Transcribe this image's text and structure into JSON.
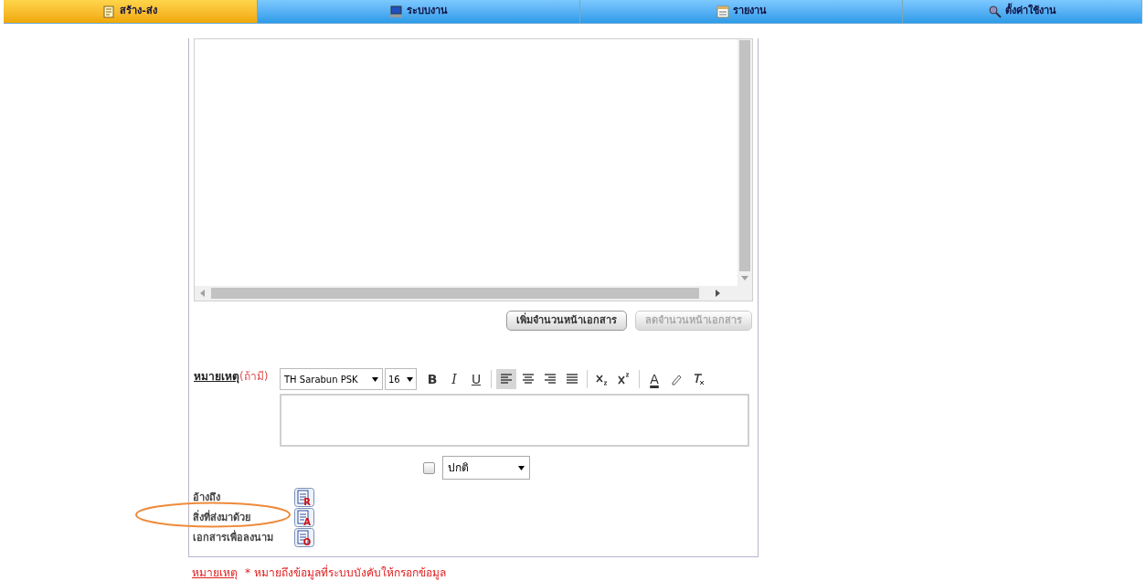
{
  "nav_tabs": [
    {
      "label": "สร้าง-ส่ง",
      "selected": true
    },
    {
      "label": "ระบบงาน",
      "selected": false
    },
    {
      "label": "รายงาน",
      "selected": false
    },
    {
      "label": "ตั้งค่าใช้งาน",
      "selected": false
    }
  ],
  "page_buttons": [
    {
      "label": "เพิ่มจำนวนหน้าเอกสาร",
      "disabled": false
    },
    {
      "label": "ลดจำนวนหน้าเอกสาร",
      "disabled": true
    }
  ],
  "remark": {
    "label": "หมายเหตุ",
    "hint": "(ถ้ามี)",
    "font": "TH Sarabun PSK",
    "size": "16",
    "toolbar": [
      {
        "kind": "bold",
        "label": "B",
        "active": false
      },
      {
        "kind": "italic",
        "label": "I",
        "active": false
      },
      {
        "kind": "underline",
        "label": "U",
        "active": false
      },
      {
        "kind": "sep"
      },
      {
        "kind": "align-left",
        "active": true
      },
      {
        "kind": "align-center",
        "active": false
      },
      {
        "kind": "align-right",
        "active": false
      },
      {
        "kind": "justify",
        "active": false
      },
      {
        "kind": "sep"
      },
      {
        "kind": "subscript",
        "active": false
      },
      {
        "kind": "superscript",
        "active": false
      },
      {
        "kind": "sep"
      },
      {
        "kind": "text-color",
        "label": "A",
        "active": false
      },
      {
        "kind": "highlight",
        "active": false
      },
      {
        "kind": "clear-format",
        "active": false
      }
    ]
  },
  "urgent": {
    "checked": false,
    "priority": "ปกติ"
  },
  "attachments": [
    {
      "label": "อ้างถึง",
      "letter": "R"
    },
    {
      "label": "สิ่งที่ส่งมาด้วย",
      "letter": "A"
    },
    {
      "label": "เอกสารเพื่อลงนาม",
      "letter": "O"
    }
  ],
  "footnote": {
    "label": "หมายเหตุ",
    "text": "* หมายถึงข้อมูลที่ระบบบังคับให้กรอกข้อมูล"
  }
}
